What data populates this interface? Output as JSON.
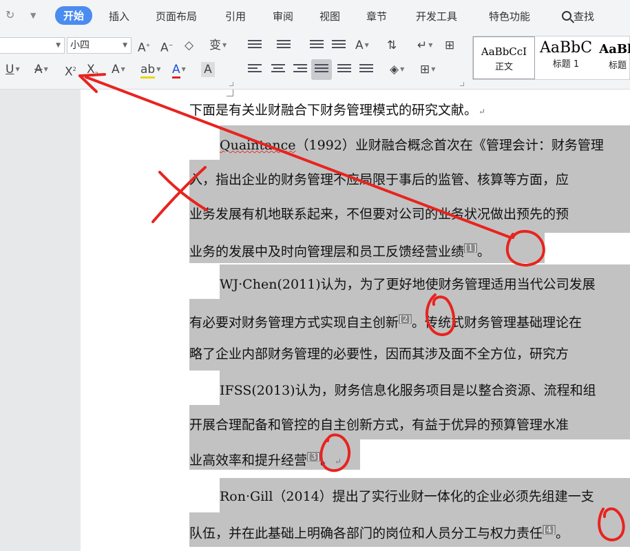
{
  "menu": {
    "tabs": [
      "开始",
      "插入",
      "页面布局",
      "引用",
      "审阅",
      "视图",
      "章节",
      "开发工具",
      "特色功能"
    ],
    "search": "查找"
  },
  "ribbon": {
    "font_size": "小四",
    "styles": [
      {
        "preview": "AaBbCcI",
        "name": "正文"
      },
      {
        "preview": "AaBbC",
        "name": "标题 1"
      },
      {
        "preview": "AaBb",
        "name": "标题"
      }
    ]
  },
  "document": {
    "intro": "下面是有关业财融合下财务管理模式的研究文献。",
    "p1": {
      "author": "Quaintance",
      "l1_rest": "（1992）业财融合概念首次在《管理会计：财务管理",
      "l2": "入，指出企业的财务管理不应局限于事后的监管、核算等方面，应",
      "l3": "业务发展有机地联系起来，不但要对公司的业务状况做出预先的预",
      "l4": "业务的发展中及时向管理层和员工反馈经营业绩",
      "cite": "[1]",
      "end": "。"
    },
    "p2": {
      "l1": "WJ·Chen(2011)认为，为了更好地使财务管理适用当代公司发展",
      "l2": "有必要对财务管理方式实现自主创新",
      "cite": "[2]",
      "l2_rest": "。传统式财务管理基础理论在",
      "l3": "略了企业内部财务管理的必要性，因而其涉及面不全方位，研究方"
    },
    "p3": {
      "l1": "IFSS(2013)认为，财务信息化服务项目是以整合资源、流程和组",
      "l2": "开展合理配备和管控的自主创新方式，有益于优异的预算管理水准",
      "l3": "业高效率和提升经营",
      "cite": "[3]",
      "end": "。"
    },
    "p4": {
      "l1": "Ron·Gill（2014）提出了实行业财一体化的企业必须先组建一支",
      "l2": "队伍，并在此基础上明确各部门的岗位和人员分工与权力责任",
      "cite": "[4]",
      "end": "。"
    }
  },
  "colors": {
    "accent": "#4a8cf0",
    "highlight": "#c2c2c2",
    "annotation": "#e8231f"
  }
}
